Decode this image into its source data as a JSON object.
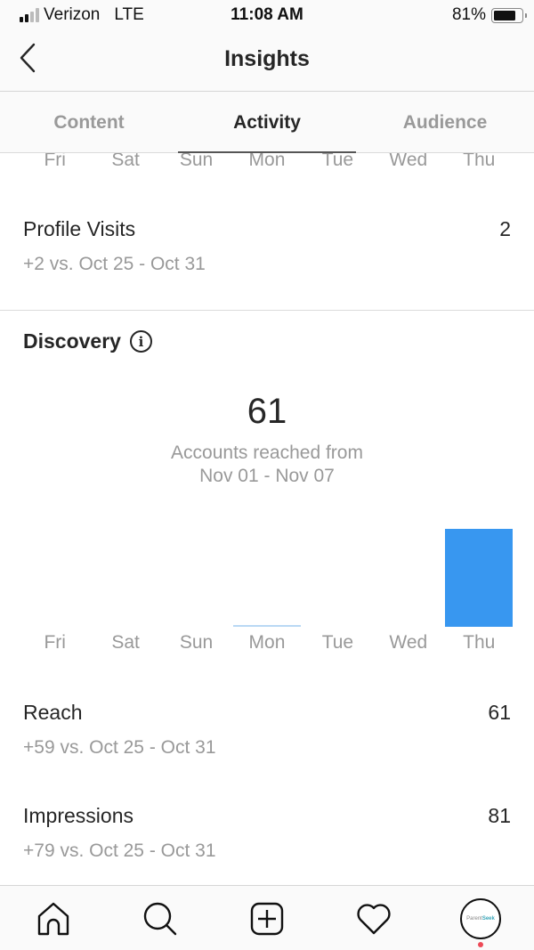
{
  "status_bar": {
    "carrier": "Verizon",
    "network": "LTE",
    "time": "11:08 AM",
    "battery_label": "81%",
    "battery_level": 0.81,
    "signal_bars_filled": 2,
    "signal_bars_total": 4
  },
  "header": {
    "title": "Insights",
    "back_icon": "chevron-left-icon"
  },
  "tabs": [
    {
      "label": "Content",
      "active": false
    },
    {
      "label": "Activity",
      "active": true
    },
    {
      "label": "Audience",
      "active": false
    }
  ],
  "previous_chart": {
    "days": [
      "Fri",
      "Sat",
      "Sun",
      "Mon",
      "Tue",
      "Wed",
      "Thu"
    ]
  },
  "profile_visits": {
    "label": "Profile Visits",
    "value": "2",
    "comparison": "+2 vs. Oct 25 - Oct 31"
  },
  "discovery": {
    "title": "Discovery",
    "info_icon": "info-icon",
    "accounts_reached": "61",
    "caption_line1": "Accounts reached from",
    "caption_line2": "Nov 01 - Nov 07",
    "bar_color": "#3897f0",
    "zero_bar_color": "#b9d8f4"
  },
  "chart_data": {
    "type": "bar",
    "title": "Accounts reached",
    "categories": [
      "Fri",
      "Sat",
      "Sun",
      "Mon",
      "Tue",
      "Wed",
      "Thu"
    ],
    "values": [
      0,
      0,
      0,
      0,
      0,
      0,
      61
    ],
    "highlight_baseline": [
      "Mon"
    ],
    "xlabel": "",
    "ylabel": "",
    "ylim": [
      0,
      61
    ],
    "grid": false,
    "legend": "none"
  },
  "reach": {
    "label": "Reach",
    "value": "61",
    "comparison": "+59 vs. Oct 25 - Oct 31"
  },
  "impressions": {
    "label": "Impressions",
    "value": "81",
    "comparison": "+79 vs. Oct 25 - Oct 31"
  },
  "tabbar": {
    "items": [
      {
        "name": "home",
        "icon": "home-icon"
      },
      {
        "name": "search",
        "icon": "search-icon"
      },
      {
        "name": "new-post",
        "icon": "plus-square-icon"
      },
      {
        "name": "activity",
        "icon": "heart-icon"
      },
      {
        "name": "profile",
        "icon": "avatar"
      }
    ],
    "avatar_text_a": "Parent",
    "avatar_text_b": "Seek",
    "notification_color": "#ed4956"
  }
}
